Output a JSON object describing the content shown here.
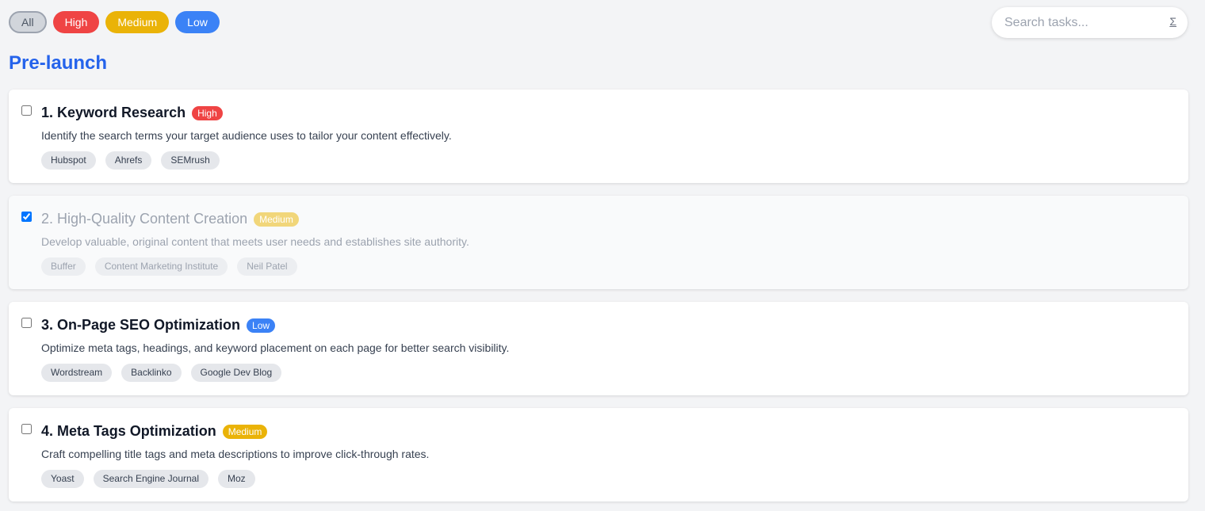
{
  "filters": {
    "all": "All",
    "high": "High",
    "medium": "Medium",
    "low": "Low"
  },
  "search": {
    "placeholder": "Search tasks...",
    "icon": "sigma-icon",
    "icon_glyph": "Σ"
  },
  "section": {
    "title": "Pre-launch"
  },
  "colors": {
    "high": "#ef4444",
    "medium": "#eab308",
    "low": "#3b82f6",
    "section_title": "#2563eb"
  },
  "tasks": [
    {
      "title": "1. Keyword Research",
      "priority": "High",
      "checked": false,
      "description": "Identify the search terms your target audience uses to tailor your content effectively.",
      "tags": [
        "Hubspot",
        "Ahrefs",
        "SEMrush"
      ]
    },
    {
      "title": "2. High-Quality Content Creation",
      "priority": "Medium",
      "checked": true,
      "description": "Develop valuable, original content that meets user needs and establishes site authority.",
      "tags": [
        "Buffer",
        "Content Marketing Institute",
        "Neil Patel"
      ]
    },
    {
      "title": "3. On-Page SEO Optimization",
      "priority": "Low",
      "checked": false,
      "description": "Optimize meta tags, headings, and keyword placement on each page for better search visibility.",
      "tags": [
        "Wordstream",
        "Backlinko",
        "Google Dev Blog"
      ]
    },
    {
      "title": "4. Meta Tags Optimization",
      "priority": "Medium",
      "checked": false,
      "description": "Craft compelling title tags and meta descriptions to improve click-through rates.",
      "tags": [
        "Yoast",
        "Search Engine Journal",
        "Moz"
      ]
    }
  ]
}
